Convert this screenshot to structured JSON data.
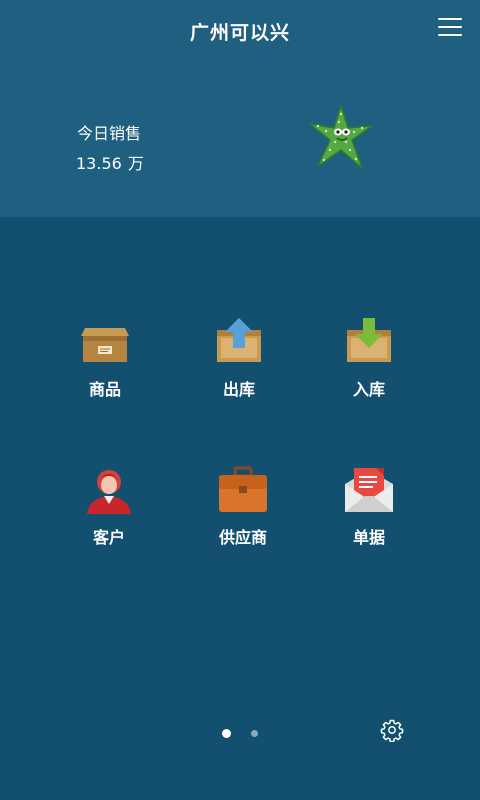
{
  "header": {
    "title": "广州可以兴",
    "menu_icon": "hamburger-menu-icon"
  },
  "sales": {
    "label": "今日销售",
    "value": "13.56",
    "unit": "万"
  },
  "mascot_icon": "starfish-mascot-icon",
  "grid": {
    "items": [
      {
        "label": "商品",
        "icon": "product-box-icon"
      },
      {
        "label": "出库",
        "icon": "stock-out-icon"
      },
      {
        "label": "入库",
        "icon": "stock-in-icon"
      },
      {
        "label": "客户",
        "icon": "customer-icon"
      },
      {
        "label": "供应商",
        "icon": "supplier-briefcase-icon"
      },
      {
        "label": "单据",
        "icon": "document-envelope-icon"
      }
    ]
  },
  "pager": {
    "pages": 2,
    "current": 1
  },
  "settings_icon": "gear-icon",
  "colors": {
    "header_background": "#1f5f7f",
    "body_background": "#134f6e",
    "text": "#ffffff"
  }
}
